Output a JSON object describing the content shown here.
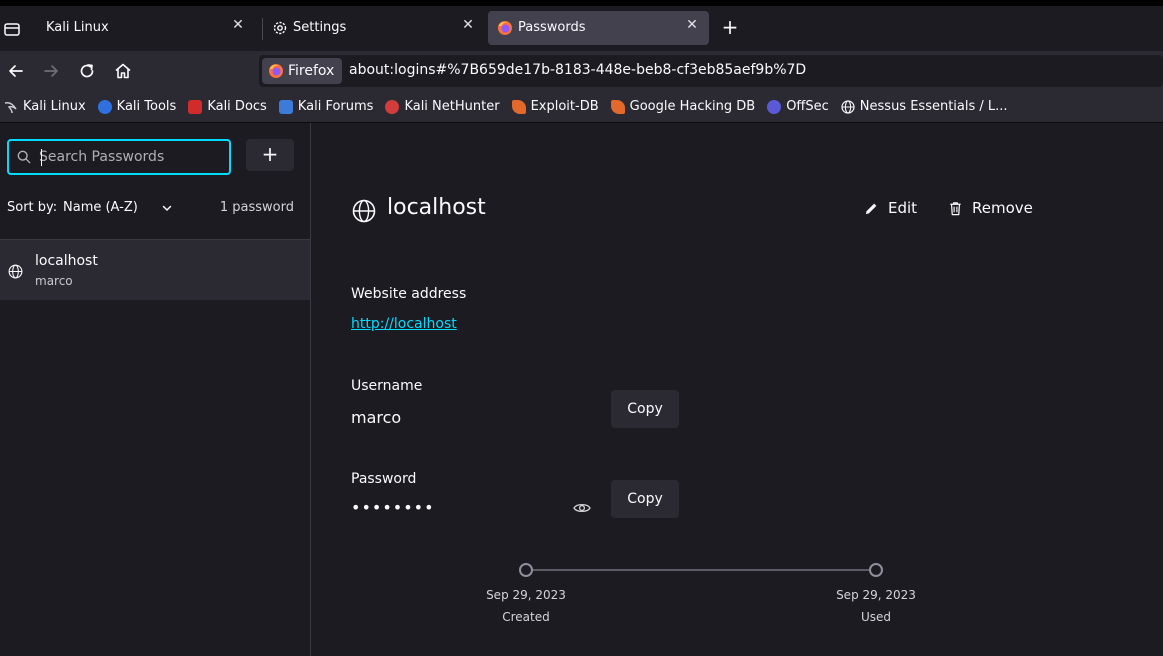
{
  "tabs": [
    {
      "label": "Kali Linux",
      "active": false
    },
    {
      "label": "Settings",
      "active": false
    },
    {
      "label": "Passwords",
      "active": true
    }
  ],
  "navbar": {
    "identity_label": "Firefox",
    "url": "about:logins#%7B659de17b-8183-448e-beb8-cf3eb85aef9b%7D"
  },
  "bookmarks": [
    {
      "label": "Kali Linux",
      "icon": "kali-dragon-icon",
      "color": "#3b3b3b"
    },
    {
      "label": "Kali Tools",
      "icon": "kali-tools-icon",
      "color": "#2f6fe0"
    },
    {
      "label": "Kali Docs",
      "icon": "kali-docs-icon",
      "color": "#d22b2b"
    },
    {
      "label": "Kali Forums",
      "icon": "kali-forums-icon",
      "color": "#3d7bd9"
    },
    {
      "label": "Kali NetHunter",
      "icon": "nethunter-icon",
      "color": "#d23c3c"
    },
    {
      "label": "Exploit-DB",
      "icon": "exploit-db-icon",
      "color": "#e2682b"
    },
    {
      "label": "Google Hacking DB",
      "icon": "ghdb-icon",
      "color": "#e2682b"
    },
    {
      "label": "OffSec",
      "icon": "offsec-icon",
      "color": "#5a5ad8"
    },
    {
      "label": "Nessus Essentials / L...",
      "icon": "globe-icon",
      "color": "#fbfbfe"
    }
  ],
  "sidebar": {
    "search_placeholder": "Search Passwords",
    "add_label": "+",
    "sort_label": "Sort by:",
    "sort_value": "Name (A-Z)",
    "count": "1 password",
    "items": [
      {
        "title": "localhost",
        "username": "marco"
      }
    ]
  },
  "detail": {
    "title": "localhost",
    "edit_label": "Edit",
    "remove_label": "Remove",
    "website_label": "Website address",
    "website_value": "http://localhost",
    "username_label": "Username",
    "username_value": "marco",
    "password_label": "Password",
    "password_masked": "••••••••",
    "copy_label": "Copy",
    "created_date": "Sep 29, 2023",
    "created_label": "Created",
    "used_date": "Sep 29, 2023",
    "used_label": "Used"
  },
  "colors": {
    "accent": "#00ddff",
    "background": "#1c1b22",
    "surface": "#2b2a33"
  }
}
